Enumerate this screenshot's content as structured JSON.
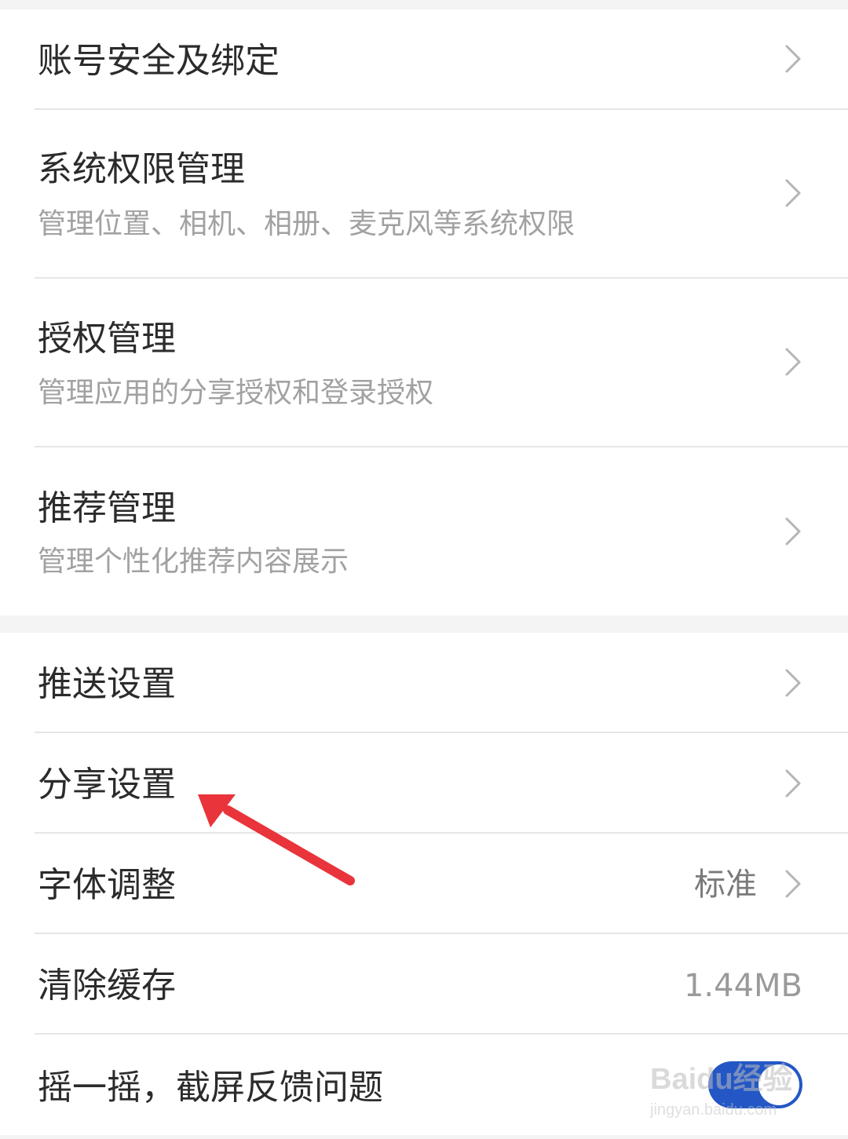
{
  "settings_group_1": {
    "items": [
      {
        "title": "账号安全及绑定"
      },
      {
        "title": "系统权限管理",
        "subtitle": "管理位置、相机、相册、麦克风等系统权限"
      },
      {
        "title": "授权管理",
        "subtitle": "管理应用的分享授权和登录授权"
      },
      {
        "title": "推荐管理",
        "subtitle": "管理个性化推荐内容展示"
      }
    ]
  },
  "settings_group_2": {
    "items": [
      {
        "title": "推送设置"
      },
      {
        "title": "分享设置"
      },
      {
        "title": "字体调整",
        "value": "标准"
      },
      {
        "title": "清除缓存",
        "value": "1.44MB"
      },
      {
        "title": "摇一摇，截屏反馈问题",
        "toggle_on": true
      }
    ]
  },
  "watermark": {
    "brand": "Baidu经验",
    "url": "jingyan.baidu.com"
  },
  "colors": {
    "toggle_on": "#2457c5",
    "annotation_arrow": "#e8343a",
    "primary_text": "#2b2b2b",
    "secondary_text": "#a1a1a1"
  }
}
